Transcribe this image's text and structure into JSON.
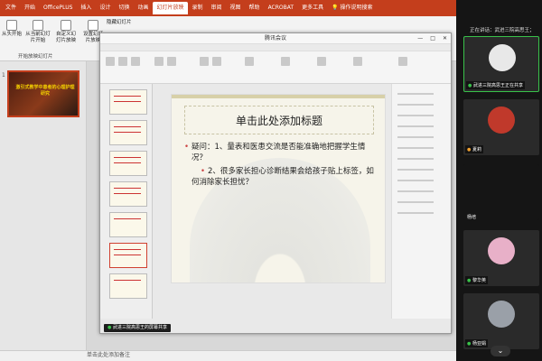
{
  "ppt": {
    "tabs": [
      "文件",
      "开始",
      "OfficePLUS",
      "插入",
      "设计",
      "切换",
      "动画",
      "幻灯片放映",
      "录制",
      "审阅",
      "视图",
      "帮助",
      "ACROBAT",
      "更多工具",
      "操作说明搜索"
    ],
    "active_tab": "幻灯片放映",
    "ribbon": {
      "from_start": "从头开始",
      "from_current": "从当前幻灯片开始",
      "custom_show": "自定义幻灯片放映",
      "setup": "设置幻灯片放映",
      "hide_slide": "隐藏幻灯片",
      "group_label": "开始放映幻灯片"
    },
    "thumb_number": "1",
    "thumb_title": "激引式教学中患者的心理护理研究",
    "notes": "单击此处添加备注"
  },
  "share_window": {
    "title": "腾讯会议",
    "slide_title": "单击此处添加标题",
    "slide_lines": [
      "疑问：1、量表和医患交流是否能准确地把握学生情况？",
      "2、很多家长担心诊断结果会给孩子贴上标签，如何消除家长担忧？"
    ],
    "share_bar": "武进三院高思王的屏幕共享"
  },
  "meeting": {
    "speaking": "正在讲话：武进三院高思王；",
    "participants": [
      {
        "name": "武进三院高思王正在共享",
        "mic": "on"
      },
      {
        "name": "夏莉",
        "mic": "muted"
      },
      {
        "name": "杨培",
        "mic": "none"
      },
      {
        "name": "黎华英",
        "mic": "on"
      },
      {
        "name": "杨亚娟",
        "mic": "on"
      }
    ]
  },
  "colors": {
    "ppt_accent": "#c43e1c",
    "meet_active": "#39c24a"
  }
}
